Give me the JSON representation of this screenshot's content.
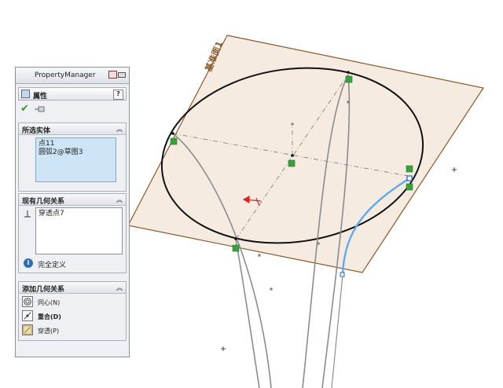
{
  "property_manager": {
    "title": "PropertyManager",
    "feature_title": "属性",
    "help_label": "?",
    "ok_glyph": "✔",
    "groups": {
      "selected_entities": {
        "title": "所选实体",
        "collapse_glyph": "︽",
        "items": [
          "点11",
          "圆弧2@草图3"
        ]
      },
      "existing_relations": {
        "title": "现有几何关系",
        "collapse_glyph": "︽",
        "items": [
          "穿透点7"
        ],
        "status_icon_glyph": "i",
        "status": "完全定义"
      },
      "add_relations": {
        "title": "添加几何关系",
        "collapse_glyph": "︽",
        "items": [
          {
            "label": "同心(N)",
            "icon": "concentric-icon",
            "bold": false
          },
          {
            "label": "重合(D)",
            "icon": "coincident-icon",
            "bold": true
          },
          {
            "label": "穿透(P)",
            "icon": "pierce-icon",
            "bold": false
          }
        ]
      }
    }
  },
  "viewport": {
    "plane_label": "基准面1",
    "colors": {
      "plane_fill": "#f5ebe0",
      "plane_edge": "#8a5a2b",
      "plane_label": "#8a5a2b",
      "circle": "#111111",
      "highlight_arc": "#5ea9ee",
      "relation_glyph": "#3aa03a",
      "construction": "#777777",
      "axis_red": "#dd2222"
    }
  }
}
